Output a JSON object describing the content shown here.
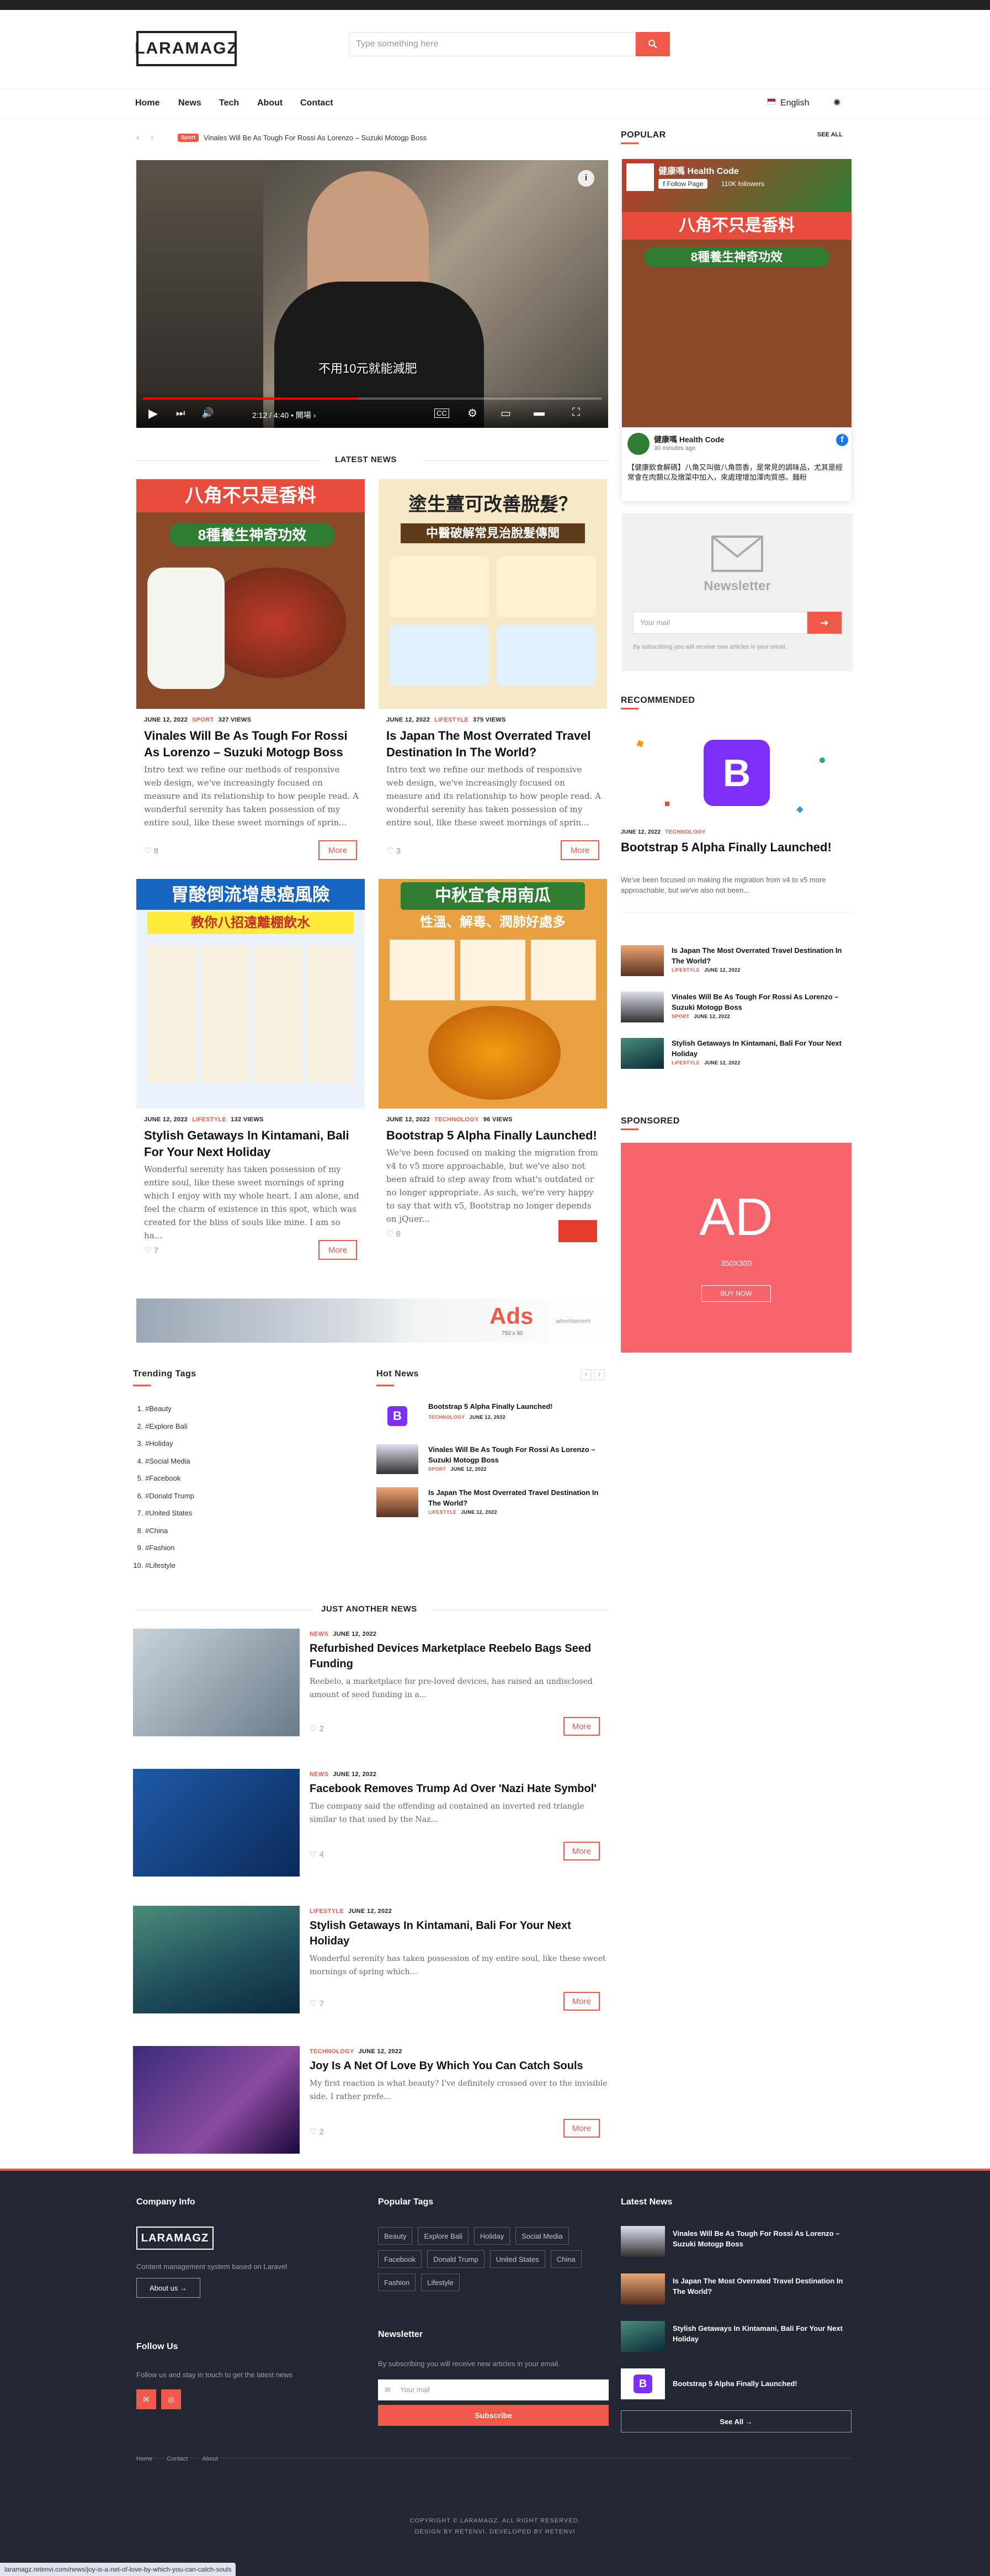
{
  "header": {
    "logo": "LARAMAGZ",
    "search_placeholder": "Type something here",
    "nav": [
      "Home",
      "News",
      "Tech",
      "About",
      "Contact"
    ],
    "language": "English"
  },
  "ticker": {
    "badge": "Sport",
    "text": "Vinales Will Be As Tough For Rossi As Lorenzo – Suzuki Motogp Boss"
  },
  "video": {
    "subtitle": "不用10元就能減肥",
    "time": "2:12 / 4:40 • 開場 ›"
  },
  "latest": {
    "title": "LATEST NEWS",
    "cards": [
      {
        "date": "JUNE 12, 2022",
        "category": "SPORT",
        "views": "327 VIEWS",
        "title": "Vinales Will Be As Tough For Rossi As Lorenzo – Suzuki Motogp Boss",
        "excerpt": "Intro text we refine our methods of responsive web design, we've increasingly focused on measure and its relationship to how people read. A wonderful serenity has taken possession of my entire soul, like these sweet mornings of sprin...",
        "likes": "8",
        "more": "More",
        "poster_title": "八角不只是香料",
        "poster_sub": "8種養生神奇功效"
      },
      {
        "date": "JUNE 12, 2022",
        "category": "LIFESTYLE",
        "views": "375 VIEWS",
        "title": "Is Japan The Most Overrated Travel Destination In The World?",
        "excerpt": "Intro text we refine our methods of responsive web design, we've increasingly focused on measure and its relationship to how people read. A wonderful serenity has taken possession of my entire soul, like these sweet mornings of sprin...",
        "likes": "3",
        "more": "More",
        "poster_title": "塗生薑可改善脫髮？",
        "poster_sub": "中醫破解常見治脫髮傳聞"
      },
      {
        "date": "JUNE 12, 2022",
        "category": "LIFESTYLE",
        "views": "132 VIEWS",
        "title": "Stylish Getaways In Kintamani, Bali For Your Next Holiday",
        "excerpt": "Wonderful serenity has taken possession of my entire soul, like these sweet mornings of spring which I enjoy with my whole heart. I am alone, and feel the charm of existence in this spot, which was created for the bliss of souls like mine. I am so ha...",
        "likes": "7",
        "more": "More",
        "poster_title": "胃酸倒流增患癌風險",
        "poster_sub": "教你八招遠離棚飲水"
      },
      {
        "date": "JUNE 12, 2022",
        "category": "TECHNOLOGY",
        "views": "96 VIEWS",
        "title": "Bootstrap 5 Alpha Finally Launched!",
        "excerpt": "We've been focused on making the migration from v4 to v5 more approachable, but we've also not been afraid to step away from what's outdated or no longer appropriate. As such, we're very happy to say that with v5, Bootstrap no longer depends on jQuer...",
        "likes": "6",
        "more": "More",
        "poster_title": "中秋宜食用南瓜",
        "poster_sub": "性溫、解毒、潤肺好處多"
      }
    ]
  },
  "ad_banner": {
    "text": "Ads",
    "size": "750 x 90",
    "label": "advertisement"
  },
  "trending": {
    "title": "Trending Tags",
    "tags": [
      "#Beauty",
      "#Explore Bali",
      "#Holiday",
      "#Social Media",
      "#Facebook",
      "#Donald Trump",
      "#United States",
      "#China",
      "#Fashion",
      "#Lifestyle"
    ]
  },
  "hot_news": {
    "title": "Hot News",
    "items": [
      {
        "title": "Bootstrap 5 Alpha Finally Launched!",
        "category": "TECHNOLOGY",
        "date": "JUNE 12, 2022"
      },
      {
        "title": "Vinales Will Be As Tough For Rossi As Lorenzo – Suzuki Motogp Boss",
        "category": "SPORT",
        "date": "JUNE 12, 2022"
      },
      {
        "title": "Is Japan The Most Overrated Travel Destination In The World?",
        "category": "LIFESTYLE",
        "date": "JUNE 12, 2022"
      }
    ]
  },
  "just_another": {
    "title": "JUST ANOTHER NEWS",
    "items": [
      {
        "category": "NEWS",
        "date": "JUNE 12, 2022",
        "title": "Refurbished Devices Marketplace Reebelo Bags Seed Funding",
        "excerpt": "Reebelo, a marketplace for pre-loved devices, has raised an undisclosed amount of seed funding in a...",
        "likes": "2",
        "more": "More"
      },
      {
        "category": "NEWS",
        "date": "JUNE 12, 2022",
        "title": "Facebook Removes Trump Ad Over 'Nazi Hate Symbol'",
        "excerpt": "The company said the offending ad contained an inverted red triangle similar to that used by the Naz...",
        "likes": "4",
        "more": "More"
      },
      {
        "category": "LIFESTYLE",
        "date": "JUNE 12, 2022",
        "title": "Stylish Getaways In Kintamani, Bali For Your Next Holiday",
        "excerpt": "Wonderful serenity has taken possession of my entire soul, like these sweet mornings of spring which...",
        "likes": "7",
        "more": "More"
      },
      {
        "category": "TECHNOLOGY",
        "date": "JUNE 12, 2022",
        "title": "Joy Is A Net Of Love By Which You Can Catch Souls",
        "excerpt": "My first reaction is what beauty? I've definitely crossed over to the invisible side. I rather prefe...",
        "likes": "2",
        "more": "More"
      }
    ]
  },
  "sidebar": {
    "popular_title": "POPULAR",
    "see_all": "SEE ALL",
    "fb_page": "健康嗎 Health Code",
    "fb_follow": "Follow Page",
    "fb_followers": "110K followers",
    "fb_post_name": "健康嗎 Health Code",
    "fb_post_time": "30 minutes ago",
    "fb_post_text": "【健康飲食解碼】八角又叫做八角茴香，是常見的調味品，尤其是經常會在肉類以及燉菜中加入，來處理增加澤肉質感。麵粉",
    "newsletter_title": "Newsletter",
    "newsletter_placeholder": "Your mail",
    "newsletter_note": "By subscribing you will receive new articles in your email.",
    "recommended_title": "RECOMMENDED",
    "rec_date": "JUNE 12, 2022",
    "rec_category": "TECHNOLOGY",
    "rec_title": "Bootstrap 5 Alpha Finally Launched!",
    "rec_excerpt": "We've been focused on making the migration from v4 to v5 more approachable, but we've also not been...",
    "rec_list": [
      {
        "title": "Is Japan The Most Overrated Travel Destination In The World?",
        "category": "LIFESTYLE",
        "date": "JUNE 12, 2022"
      },
      {
        "title": "Vinales Will Be As Tough For Rossi As Lorenzo – Suzuki Motogp Boss",
        "category": "SPORT",
        "date": "JUNE 12, 2022"
      },
      {
        "title": "Stylish Getaways In Kintamani, Bali For Your Next Holiday",
        "category": "LIFESTYLE",
        "date": "JUNE 12, 2022"
      }
    ],
    "sponsored_title": "SPONSORED",
    "ad_text": "AD",
    "ad_size": "350X300",
    "ad_button": "BUY NOW"
  },
  "footer": {
    "company_title": "Company Info",
    "logo": "LARAMAGZ",
    "company_text": "Content management system based on Laravel",
    "about_button": "About us →",
    "follow_title": "Follow Us",
    "follow_text": "Follow us and stay in touch to get the latest news",
    "tags_title": "Popular Tags",
    "tags": [
      "Beauty",
      "Explore Bali",
      "Holiday",
      "Social Media",
      "Facebook",
      "Donald Trump",
      "United States",
      "China",
      "Fashion",
      "Lifestyle"
    ],
    "newsletter_title": "Newsletter",
    "newsletter_text": "By subscribing you will receive new articles in your email.",
    "newsletter_placeholder": "Your mail",
    "subscribe": "Subscribe",
    "latest_title": "Latest News",
    "latest": [
      {
        "title": "Vinales Will Be As Tough For Rossi As Lorenzo – Suzuki Motogp Boss"
      },
      {
        "title": "Is Japan The Most Overrated Travel Destination In The World?"
      },
      {
        "title": "Stylish Getaways In Kintamani, Bali For Your Next Holiday"
      },
      {
        "title": "Bootstrap 5 Alpha Finally Launched!"
      }
    ],
    "see_all": "See All →",
    "links": [
      "Home",
      "Contact",
      "About"
    ],
    "copyright": "COPYRIGHT © LARAMAGZ. ALL RIGHT RESERVED.",
    "credit": "DESIGN BY RETENVI. DEVELOPED BY RETENVI",
    "status_url": "laramagz.retenvi.com/news/joy-is-a-net-of-love-by-which-you-can-catch-souls"
  },
  "colors": {
    "accent": "#f0594a",
    "footer_bg": "#232733"
  }
}
